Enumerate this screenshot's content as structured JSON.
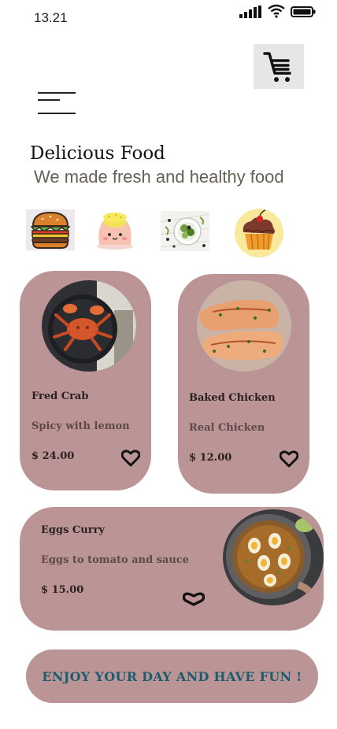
{
  "status_bar": {
    "time": "13.21"
  },
  "header": {
    "title": "Delicious Food",
    "subtitle": "We made fresh and healthy food"
  },
  "icons": {
    "cart": "shopping-cart-icon",
    "menu": "hamburger-menu-icon",
    "heart": "heart-icon"
  },
  "categories": [
    {
      "icon": "burger"
    },
    {
      "icon": "pudding"
    },
    {
      "icon": "salad"
    },
    {
      "icon": "cupcake"
    }
  ],
  "foods": [
    {
      "name": "Fred Crab",
      "description": "Spicy with lemon",
      "price": "$ 24.00"
    },
    {
      "name": "Baked Chicken",
      "description": "Real Chicken",
      "price": "$ 12.00"
    },
    {
      "name": "Eggs Curry",
      "description": "Eggs to tomato and sauce",
      "price": "$ 15.00"
    }
  ],
  "banner": {
    "text": "ENJOY YOUR DAY AND HAVE FUN !"
  },
  "colors": {
    "card": "#bb9595",
    "banner_text": "#1d5c6e",
    "cart_bg": "#e6e6e6"
  }
}
